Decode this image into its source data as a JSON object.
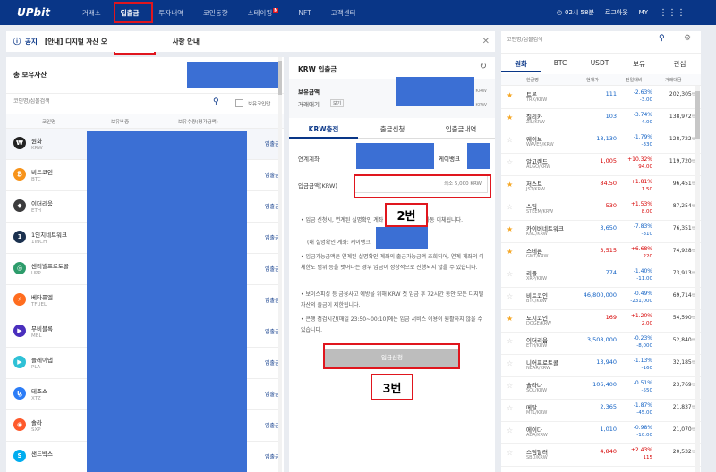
{
  "nav": {
    "logo": "UPbit",
    "menu": [
      "거래소",
      "입출금",
      "투자내역",
      "코인동향",
      "스테이킹",
      "NFT",
      "고객센터"
    ],
    "staking_badge": "N",
    "time": "02시 58분",
    "logout": "로그아웃",
    "my": "MY"
  },
  "annotations": {
    "step1": "1번",
    "step2": "2번",
    "step3": "3번"
  },
  "notice": {
    "label": "공지",
    "text": "[안내] 디지털 자산 오",
    "text_tail": "사항 안내"
  },
  "holdings": {
    "title": "총 보유자산",
    "search_placeholder": "코인명/심볼검색",
    "hide_zero_label": "보유코인만",
    "columns": [
      "코인명",
      "보유비중",
      "보유수량(평가금액)"
    ],
    "deposit_label": "입출금",
    "coins": [
      {
        "name": "원화",
        "symbol": "KRW",
        "icon": "₩",
        "color": "#222222"
      },
      {
        "name": "비트코인",
        "symbol": "BTC",
        "icon": "₿",
        "color": "#f7931a"
      },
      {
        "name": "이더리움",
        "symbol": "ETH",
        "icon": "◆",
        "color": "#3c3c3d"
      },
      {
        "name": "1인치네트워크",
        "symbol": "1INCH",
        "icon": "1",
        "color": "#1b314f"
      },
      {
        "name": "센티넬프로토콜",
        "symbol": "UPP",
        "icon": "◎",
        "color": "#2d9c6b"
      },
      {
        "name": "베타퓨엘",
        "symbol": "TFUEL",
        "icon": "⚡",
        "color": "#ff6d1f"
      },
      {
        "name": "무비블록",
        "symbol": "MBL",
        "icon": "▶",
        "color": "#4a2fbd"
      },
      {
        "name": "플레이댑",
        "symbol": "PLA",
        "icon": "▶",
        "color": "#2fc1d6"
      },
      {
        "name": "테조스",
        "symbol": "XTZ",
        "icon": "ꜩ",
        "color": "#2c7df7"
      },
      {
        "name": "솔라",
        "symbol": "SXP",
        "icon": "◉",
        "color": "#fe5a2c"
      },
      {
        "name": "샌드박스",
        "symbol": "",
        "icon": "S",
        "color": "#00adef"
      }
    ]
  },
  "krw": {
    "title": "KRW 입출금",
    "balance_label": "보유금액",
    "balance_unit": "KRW",
    "pending_label": "거래대기",
    "view_label": "보기",
    "tabs": [
      "KRW충전",
      "출금신청",
      "입출금내역"
    ],
    "linked_account_label": "연계계좌",
    "bank": "케이뱅크",
    "amount_label": "입금금액(KRW)",
    "amount_placeholder": "최소 5,000 KRW",
    "notes": [
      "입금 신청시, 연계된 실명확인 계좌              확인 업데이트 중 자동 이체됩니다.",
      "(내 실명확인 계좌: 케이뱅크",
      "입금가능금액은 연계된 실명확인 계좌의 출금가능금액 조회되어, 연계 계좌의 이체한도 범위 등을 벗어나는 경우 입금이 정상적으로 진행되지 않을 수 있습니다.",
      "보이스피싱 등 금융사고 예방을 위해 KRW 첫 입금 후 72시간 동안 모든 디지털 자산의 출금이 제한됩니다.",
      "은행 점검시간(매일 23:50~00:10)에는 입금 서비스 이용이 원활하지 않을 수 있습니다."
    ],
    "submit": "입금신청"
  },
  "market": {
    "search_placeholder": "코인명/심볼검색",
    "tabs": [
      "원화",
      "BTC",
      "USDT",
      "보유",
      "관심"
    ],
    "columns": [
      "한글명",
      "현재가",
      "전일대비",
      "거래대금"
    ],
    "vol_unit": "백만",
    "rows": [
      {
        "name": "트론",
        "sym": "TRX/KRW",
        "price": "111",
        "pct": "-2.63%",
        "diff": "-3.00",
        "vol": "202,305",
        "dir": "dn",
        "star": true
      },
      {
        "name": "질리카",
        "sym": "ZIL/KRW",
        "price": "103",
        "pct": "-3.74%",
        "diff": "-4.00",
        "vol": "138,972",
        "dir": "dn",
        "star": true
      },
      {
        "name": "웨이브",
        "sym": "WAVES/KRW",
        "price": "18,130",
        "pct": "-1.79%",
        "diff": "-330",
        "vol": "128,722",
        "dir": "dn",
        "star": false
      },
      {
        "name": "알고랜드",
        "sym": "ALGO/KRW",
        "price": "1,005",
        "pct": "+10.32%",
        "diff": "94.00",
        "vol": "119,720",
        "dir": "up",
        "star": false
      },
      {
        "name": "저스트",
        "sym": "JST/KRW",
        "price": "84.50",
        "pct": "+1.81%",
        "diff": "1.50",
        "vol": "96,451",
        "dir": "up",
        "star": true
      },
      {
        "name": "스팀",
        "sym": "STEEM/KRW",
        "price": "530",
        "pct": "+1.53%",
        "diff": "8.00",
        "vol": "87,254",
        "dir": "up",
        "star": false
      },
      {
        "name": "카이버네트워크",
        "sym": "KNC/KRW",
        "price": "3,650",
        "pct": "-7.83%",
        "diff": "-310",
        "vol": "76,351",
        "dir": "dn",
        "star": true
      },
      {
        "name": "스테픈",
        "sym": "GMT/KRW",
        "price": "3,515",
        "pct": "+6.68%",
        "diff": "220",
        "vol": "74,928",
        "dir": "up",
        "star": true
      },
      {
        "name": "리플",
        "sym": "XRP/KRW",
        "price": "774",
        "pct": "-1.40%",
        "diff": "-11.00",
        "vol": "73,913",
        "dir": "dn",
        "star": false
      },
      {
        "name": "비트코인",
        "sym": "BTC/KRW",
        "price": "46,800,000",
        "pct": "-0.49%",
        "diff": "-231,000",
        "vol": "69,714",
        "dir": "dn",
        "star": false
      },
      {
        "name": "도지코인",
        "sym": "DOGE/KRW",
        "price": "169",
        "pct": "+1.20%",
        "diff": "2.00",
        "vol": "54,590",
        "dir": "up",
        "star": true
      },
      {
        "name": "이더리움",
        "sym": "ETH/KRW",
        "price": "3,508,000",
        "pct": "-0.23%",
        "diff": "-8,000",
        "vol": "52,840",
        "dir": "dn",
        "star": false
      },
      {
        "name": "니어프로토콜",
        "sym": "NEAR/KRW",
        "price": "13,940",
        "pct": "-1.13%",
        "diff": "-160",
        "vol": "32,185",
        "dir": "dn",
        "star": false
      },
      {
        "name": "솔라나",
        "sym": "SOL/KRW",
        "price": "106,400",
        "pct": "-0.51%",
        "diff": "-550",
        "vol": "23,769",
        "dir": "dn",
        "star": false
      },
      {
        "name": "메탈",
        "sym": "MTL/KRW",
        "price": "2,365",
        "pct": "-1.87%",
        "diff": "-45.00",
        "vol": "21,837",
        "dir": "dn",
        "star": false
      },
      {
        "name": "에이다",
        "sym": "ADA/KRW",
        "price": "1,010",
        "pct": "-0.98%",
        "diff": "-10.00",
        "vol": "21,070",
        "dir": "dn",
        "star": false
      },
      {
        "name": "스팀달러",
        "sym": "SBD/KRW",
        "price": "4,840",
        "pct": "+2.43%",
        "diff": "115",
        "vol": "20,532",
        "dir": "up",
        "star": false
      }
    ]
  }
}
